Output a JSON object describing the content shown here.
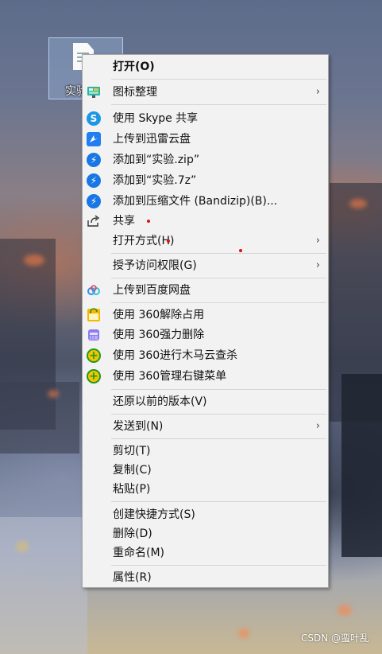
{
  "desktop": {
    "selected_icon_label": "实验",
    "watermark": "CSDN @蛮叶乱"
  },
  "menu": {
    "items": [
      {
        "label": "打开(O)"
      },
      {
        "label": "图标整理"
      },
      {
        "label": "使用 Skype 共享"
      },
      {
        "label": "上传到迅雷云盘"
      },
      {
        "label": "添加到“实验.zip”"
      },
      {
        "label": "添加到“实验.7z”"
      },
      {
        "label": "添加到压缩文件 (Bandizip)(B)..."
      },
      {
        "label": "共享"
      },
      {
        "label": "打开方式(H)"
      },
      {
        "label": "授予访问权限(G)"
      },
      {
        "label": "上传到百度网盘"
      },
      {
        "label": "使用 360解除占用"
      },
      {
        "label": "使用 360强力删除"
      },
      {
        "label": "使用 360进行木马云查杀"
      },
      {
        "label": "使用 360管理右键菜单"
      },
      {
        "label": "还原以前的版本(V)"
      },
      {
        "label": "发送到(N)"
      },
      {
        "label": "剪切(T)"
      },
      {
        "label": "复制(C)"
      },
      {
        "label": "粘贴(P)"
      },
      {
        "label": "创建快捷方式(S)"
      },
      {
        "label": "删除(D)"
      },
      {
        "label": "重命名(M)"
      },
      {
        "label": "属性(R)"
      }
    ],
    "submenu_arrow": "›",
    "icons": {
      "skype": "S",
      "bandizip": "⚡",
      "share": "⇪",
      "trojan_plus": "+"
    }
  },
  "colors": {
    "menu_bg": "#f2f2f2",
    "skype_blue": "#1e96e6",
    "bandizip_blue": "#1877e5",
    "threesixty_green": "#1e9a1e",
    "threesixty_yellow": "#f5c400",
    "marker_red": "#e01010"
  }
}
